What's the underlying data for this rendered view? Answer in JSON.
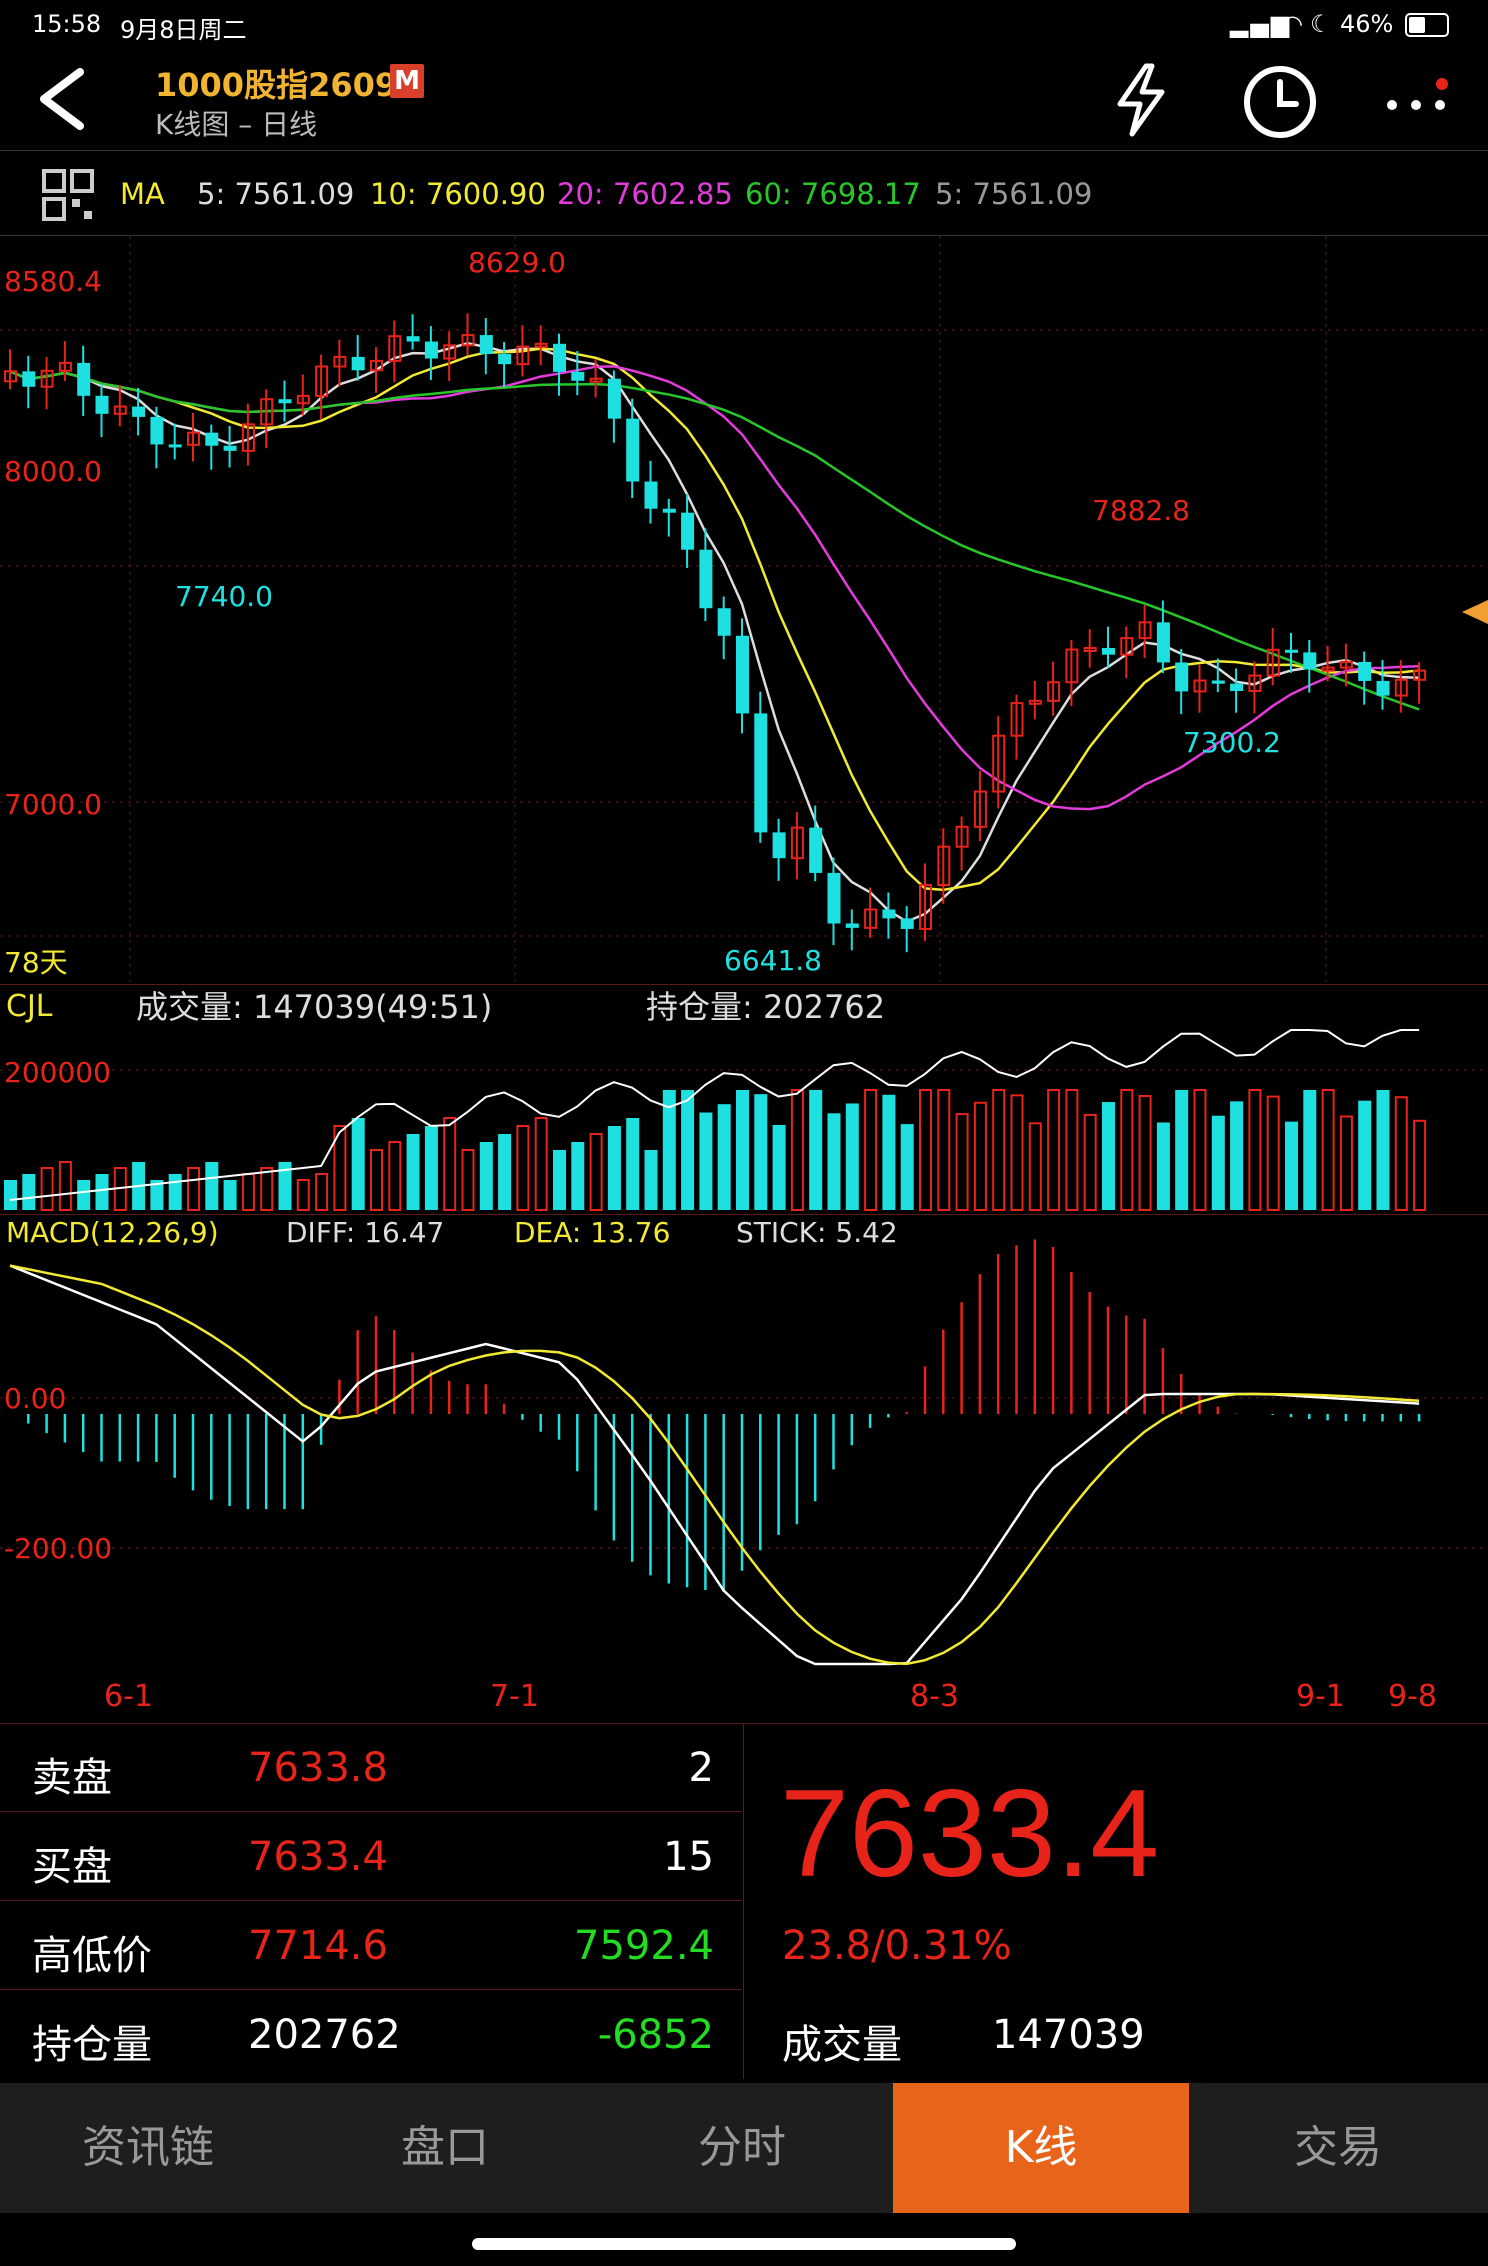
{
  "status_bar": {
    "time": "15:58",
    "date": "9月8日周二",
    "battery": "46%"
  },
  "header": {
    "title": "1000股指2609",
    "badge": "M",
    "subtitle": "K线图 – 日线"
  },
  "ma_bar": {
    "label": "MA",
    "ma5": "5: 7561.09",
    "ma10": "10: 7600.90",
    "ma20": "20: 7602.85",
    "ma60": "60: 7698.17",
    "ma5b": "5: 7561.09",
    "colors": {
      "ma5": "#dddddd",
      "ma10": "#f2e933",
      "ma20": "#e43bdc",
      "ma60": "#27c72a"
    }
  },
  "kline": {
    "price_labels": [
      "8580.4",
      "8000.0",
      "7000.0"
    ],
    "annotations": {
      "high": "8629.0",
      "low1": "7740.0",
      "peak2": "7882.8",
      "low2": "6641.8",
      "low3": "7300.2"
    },
    "days": "78天"
  },
  "volume": {
    "label": "CJL",
    "volume_text": "成交量: 147039(49:51)",
    "oi_text": "持仓量: 202762",
    "axis_label": "200000"
  },
  "macd": {
    "label": "MACD(12,26,9)",
    "diff": "DIFF: 16.47",
    "dea": "DEA: 13.76",
    "stick": "STICK: 5.42",
    "axis_labels": [
      "0.00",
      "-200.00"
    ]
  },
  "dates": [
    "6-1",
    "7-1",
    "8-3",
    "9-1",
    "9-8"
  ],
  "chart_data": {
    "type": "candlestick",
    "ylim": [
      6641.8,
      8629.0
    ],
    "last_price": 7633.4,
    "marked_points": [
      {
        "label": "8629.0",
        "kind": "high"
      },
      {
        "label": "6641.8",
        "kind": "low"
      },
      {
        "label": "7882.8",
        "kind": "local-high"
      },
      {
        "label": "7740.0",
        "kind": "local-low"
      },
      {
        "label": "7300.2",
        "kind": "local-low"
      }
    ]
  },
  "quote": {
    "rows": [
      {
        "label": "卖盘",
        "v1": "7633.8",
        "v2": "2"
      },
      {
        "label": "买盘",
        "v1": "7633.4",
        "v2": "15"
      },
      {
        "label": "高低价",
        "v1": "7714.6",
        "v2": "7592.4"
      },
      {
        "label": "持仓量",
        "v1": "202762",
        "v2": "-6852"
      }
    ],
    "price": "7633.4",
    "change": "23.8/0.31%",
    "volume_label": "成交量",
    "volume_value": "147039"
  },
  "tabs": [
    "资讯链",
    "盘口",
    "分时",
    "K线",
    "交易"
  ],
  "colors": {
    "up": "#e8231a",
    "down": "#1fe0e0",
    "accent": "#e8641a",
    "title": "#f0b431"
  }
}
